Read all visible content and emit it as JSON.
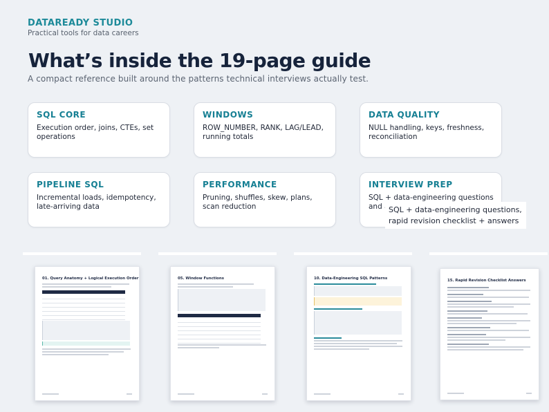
{
  "header": {
    "brand": "DATAREADY STUDIO",
    "tagline": "Practical tools for data careers",
    "title": "What’s inside the 19-page guide",
    "subtitle": "A compact reference built around the patterns technical interviews actually test."
  },
  "cards": [
    {
      "title": "SQL CORE",
      "desc": "Execution order, joins, CTEs, set operations"
    },
    {
      "title": "WINDOWS",
      "desc": "ROW_NUMBER, RANK, LAG/LEAD, running totals"
    },
    {
      "title": "DATA QUALITY",
      "desc": "NULL handling, keys, freshness, reconciliation"
    },
    {
      "title": "PIPELINE SQL",
      "desc": "Incremental loads, idempotency, late-arriving data"
    },
    {
      "title": "PERFORMANCE",
      "desc": "Pruning, shuffles, skew, plans, scan reduction"
    },
    {
      "title": "INTERVIEW PREP",
      "desc": "SQL + data-engineering questions and a"
    }
  ],
  "overlay": {
    "line1": "SQL + data-engineering questions,",
    "line2": "rapid revision checklist + answers"
  },
  "previews": [
    {
      "title": "01. Query Anatomy + Logical Execution Order"
    },
    {
      "title": "05. Window Functions"
    },
    {
      "title": "10. Data-Engineering SQL Patterns"
    },
    {
      "title": "15. Rapid Revision Checklist Answers"
    }
  ],
  "colors": {
    "background": "#eef1f5",
    "accent": "#157f93",
    "headline": "#16233b",
    "card_border": "#d9dde4"
  }
}
